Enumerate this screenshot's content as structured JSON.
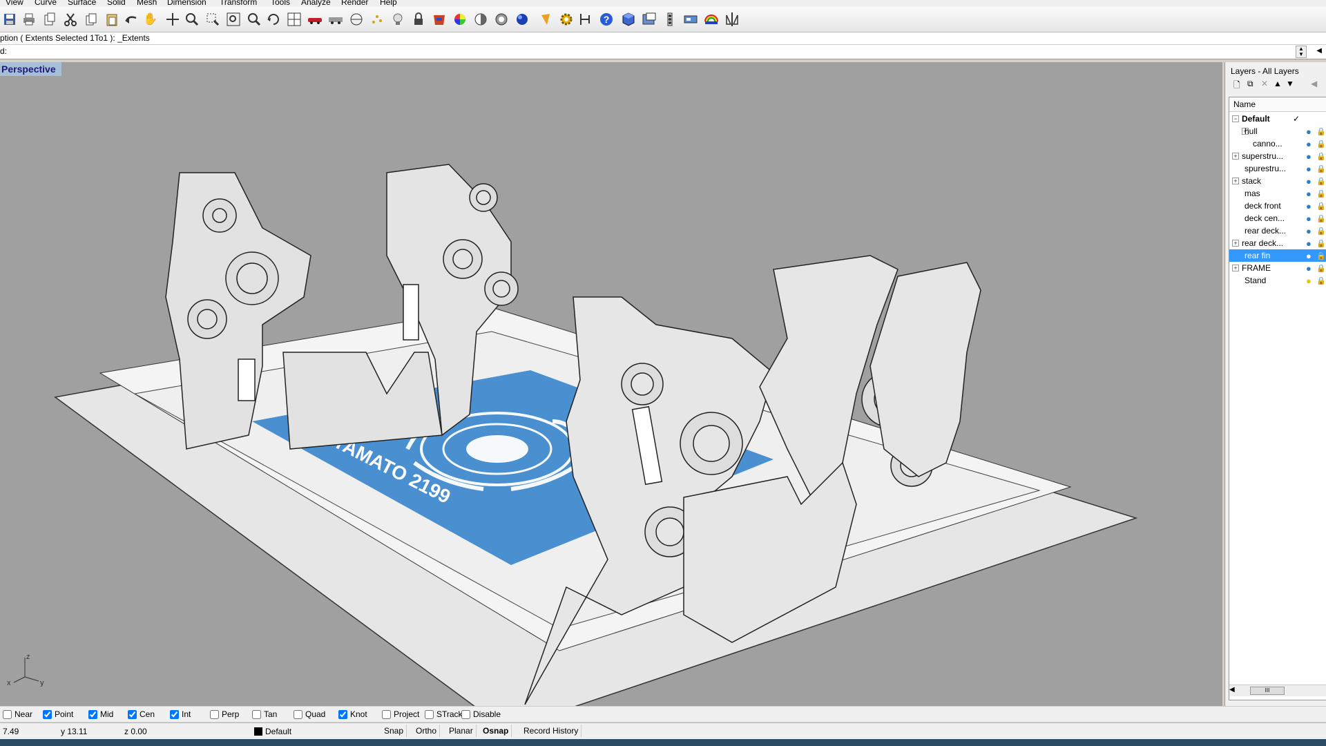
{
  "menu": [
    "View",
    "Curve",
    "Surface",
    "Solid",
    "Mesh",
    "Dimension",
    "Transform",
    "Tools",
    "Analyze",
    "Render",
    "Help"
  ],
  "toolbar": {
    "icons": [
      "save-icon",
      "print-icon",
      "copy-to-clipboard-icon",
      "cut-icon",
      "copy-icon",
      "paste-icon",
      "undo-icon",
      "pan-icon",
      "move-icon",
      "zoom-icon",
      "zoom-window-icon",
      "zoom-extents-icon",
      "zoom-selected-icon",
      "rotate-view-icon",
      "four-viewports-icon",
      "car-icon",
      "truck-icon",
      "cplane-icon",
      "points-icon",
      "light-bulb-icon",
      "lock-icon",
      "layer-color-icon",
      "color-wheel-icon",
      "shade-icon",
      "render-preview-icon",
      "render-sphere-icon",
      "render-icon",
      "options-gear-icon",
      "grid-snap-icon",
      "help-icon",
      "box-icon",
      "object-properties-icon",
      "toolbar-layout-icon",
      "viewport-properties-icon",
      "render-tools-icon",
      "mirror-icon"
    ]
  },
  "command": {
    "history": "ption ( Extents  Selected  1To1 ): _Extents",
    "prompt": "d:",
    "value": ""
  },
  "viewport": {
    "label": "Perspective",
    "axes": {
      "z": "z",
      "x": "x",
      "y": "y"
    },
    "decal": {
      "brand": "YAMATO 2199"
    }
  },
  "layers": {
    "title": "Layers - All Layers",
    "column_header": "Name",
    "rows": [
      {
        "name": "Default",
        "indent": 0,
        "expander": "−",
        "current": true
      },
      {
        "name": "hull",
        "indent": 1,
        "expander": "+"
      },
      {
        "name": "canno...",
        "indent": 2,
        "expander": ""
      },
      {
        "name": "superstru...",
        "indent": 0,
        "expander": "+"
      },
      {
        "name": "spurestru...",
        "indent": 1,
        "expander": ""
      },
      {
        "name": "stack",
        "indent": 0,
        "expander": "+"
      },
      {
        "name": "mas",
        "indent": 1,
        "expander": ""
      },
      {
        "name": "deck front",
        "indent": 1,
        "expander": ""
      },
      {
        "name": "deck cen...",
        "indent": 1,
        "expander": ""
      },
      {
        "name": "rear deck...",
        "indent": 1,
        "expander": ""
      },
      {
        "name": "rear deck...",
        "indent": 0,
        "expander": "+"
      },
      {
        "name": "rear fin",
        "indent": 1,
        "expander": "",
        "selected": true
      },
      {
        "name": "FRAME",
        "indent": 0,
        "expander": "+"
      },
      {
        "name": "Stand",
        "indent": 1,
        "expander": "",
        "bulb_color": "#e8c800"
      }
    ],
    "current_mark": "✓",
    "hscroll_grip": "III"
  },
  "osnap": [
    {
      "label": "Near",
      "checked": false
    },
    {
      "label": "Point",
      "checked": true
    },
    {
      "label": "Mid",
      "checked": true
    },
    {
      "label": "Cen",
      "checked": true
    },
    {
      "label": "Int",
      "checked": true
    },
    {
      "label": "Perp",
      "checked": false
    },
    {
      "label": "Tan",
      "checked": false
    },
    {
      "label": "Quad",
      "checked": false
    },
    {
      "label": "Knot",
      "checked": true
    },
    {
      "label": "Project",
      "checked": false
    },
    {
      "label": "STrack",
      "checked": false
    },
    {
      "label": "Disable",
      "checked": false
    }
  ],
  "status": {
    "x": "7.49",
    "y": "y 13.11",
    "z": "z 0.00",
    "layer": "Default",
    "buttons": [
      "Snap",
      "Ortho",
      "Planar",
      "Osnap",
      "Record History"
    ],
    "bold_button": "Osnap"
  },
  "colors": {
    "viewport_bg": "#a0a0a0",
    "decal_blue": "#4a90d0",
    "selection": "#3399ff",
    "viewport_label_bg": "#a6bfd6"
  }
}
